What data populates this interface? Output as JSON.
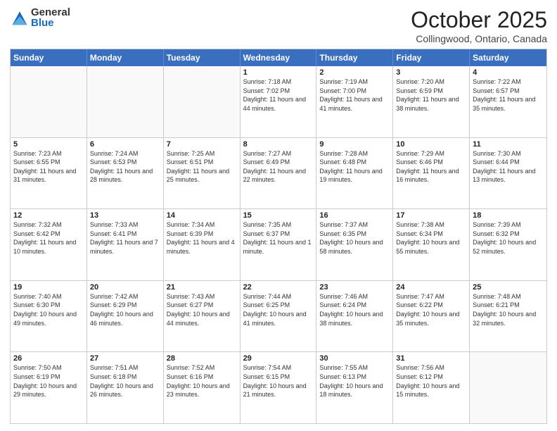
{
  "logo": {
    "general": "General",
    "blue": "Blue"
  },
  "header": {
    "month": "October 2025",
    "location": "Collingwood, Ontario, Canada"
  },
  "weekdays": [
    "Sunday",
    "Monday",
    "Tuesday",
    "Wednesday",
    "Thursday",
    "Friday",
    "Saturday"
  ],
  "weeks": [
    [
      {
        "day": "",
        "info": ""
      },
      {
        "day": "",
        "info": ""
      },
      {
        "day": "",
        "info": ""
      },
      {
        "day": "1",
        "info": "Sunrise: 7:18 AM\nSunset: 7:02 PM\nDaylight: 11 hours and 44 minutes."
      },
      {
        "day": "2",
        "info": "Sunrise: 7:19 AM\nSunset: 7:00 PM\nDaylight: 11 hours and 41 minutes."
      },
      {
        "day": "3",
        "info": "Sunrise: 7:20 AM\nSunset: 6:59 PM\nDaylight: 11 hours and 38 minutes."
      },
      {
        "day": "4",
        "info": "Sunrise: 7:22 AM\nSunset: 6:57 PM\nDaylight: 11 hours and 35 minutes."
      }
    ],
    [
      {
        "day": "5",
        "info": "Sunrise: 7:23 AM\nSunset: 6:55 PM\nDaylight: 11 hours and 31 minutes."
      },
      {
        "day": "6",
        "info": "Sunrise: 7:24 AM\nSunset: 6:53 PM\nDaylight: 11 hours and 28 minutes."
      },
      {
        "day": "7",
        "info": "Sunrise: 7:25 AM\nSunset: 6:51 PM\nDaylight: 11 hours and 25 minutes."
      },
      {
        "day": "8",
        "info": "Sunrise: 7:27 AM\nSunset: 6:49 PM\nDaylight: 11 hours and 22 minutes."
      },
      {
        "day": "9",
        "info": "Sunrise: 7:28 AM\nSunset: 6:48 PM\nDaylight: 11 hours and 19 minutes."
      },
      {
        "day": "10",
        "info": "Sunrise: 7:29 AM\nSunset: 6:46 PM\nDaylight: 11 hours and 16 minutes."
      },
      {
        "day": "11",
        "info": "Sunrise: 7:30 AM\nSunset: 6:44 PM\nDaylight: 11 hours and 13 minutes."
      }
    ],
    [
      {
        "day": "12",
        "info": "Sunrise: 7:32 AM\nSunset: 6:42 PM\nDaylight: 11 hours and 10 minutes."
      },
      {
        "day": "13",
        "info": "Sunrise: 7:33 AM\nSunset: 6:41 PM\nDaylight: 11 hours and 7 minutes."
      },
      {
        "day": "14",
        "info": "Sunrise: 7:34 AM\nSunset: 6:39 PM\nDaylight: 11 hours and 4 minutes."
      },
      {
        "day": "15",
        "info": "Sunrise: 7:35 AM\nSunset: 6:37 PM\nDaylight: 11 hours and 1 minute."
      },
      {
        "day": "16",
        "info": "Sunrise: 7:37 AM\nSunset: 6:35 PM\nDaylight: 10 hours and 58 minutes."
      },
      {
        "day": "17",
        "info": "Sunrise: 7:38 AM\nSunset: 6:34 PM\nDaylight: 10 hours and 55 minutes."
      },
      {
        "day": "18",
        "info": "Sunrise: 7:39 AM\nSunset: 6:32 PM\nDaylight: 10 hours and 52 minutes."
      }
    ],
    [
      {
        "day": "19",
        "info": "Sunrise: 7:40 AM\nSunset: 6:30 PM\nDaylight: 10 hours and 49 minutes."
      },
      {
        "day": "20",
        "info": "Sunrise: 7:42 AM\nSunset: 6:29 PM\nDaylight: 10 hours and 46 minutes."
      },
      {
        "day": "21",
        "info": "Sunrise: 7:43 AM\nSunset: 6:27 PM\nDaylight: 10 hours and 44 minutes."
      },
      {
        "day": "22",
        "info": "Sunrise: 7:44 AM\nSunset: 6:25 PM\nDaylight: 10 hours and 41 minutes."
      },
      {
        "day": "23",
        "info": "Sunrise: 7:46 AM\nSunset: 6:24 PM\nDaylight: 10 hours and 38 minutes."
      },
      {
        "day": "24",
        "info": "Sunrise: 7:47 AM\nSunset: 6:22 PM\nDaylight: 10 hours and 35 minutes."
      },
      {
        "day": "25",
        "info": "Sunrise: 7:48 AM\nSunset: 6:21 PM\nDaylight: 10 hours and 32 minutes."
      }
    ],
    [
      {
        "day": "26",
        "info": "Sunrise: 7:50 AM\nSunset: 6:19 PM\nDaylight: 10 hours and 29 minutes."
      },
      {
        "day": "27",
        "info": "Sunrise: 7:51 AM\nSunset: 6:18 PM\nDaylight: 10 hours and 26 minutes."
      },
      {
        "day": "28",
        "info": "Sunrise: 7:52 AM\nSunset: 6:16 PM\nDaylight: 10 hours and 23 minutes."
      },
      {
        "day": "29",
        "info": "Sunrise: 7:54 AM\nSunset: 6:15 PM\nDaylight: 10 hours and 21 minutes."
      },
      {
        "day": "30",
        "info": "Sunrise: 7:55 AM\nSunset: 6:13 PM\nDaylight: 10 hours and 18 minutes."
      },
      {
        "day": "31",
        "info": "Sunrise: 7:56 AM\nSunset: 6:12 PM\nDaylight: 10 hours and 15 minutes."
      },
      {
        "day": "",
        "info": ""
      }
    ]
  ]
}
